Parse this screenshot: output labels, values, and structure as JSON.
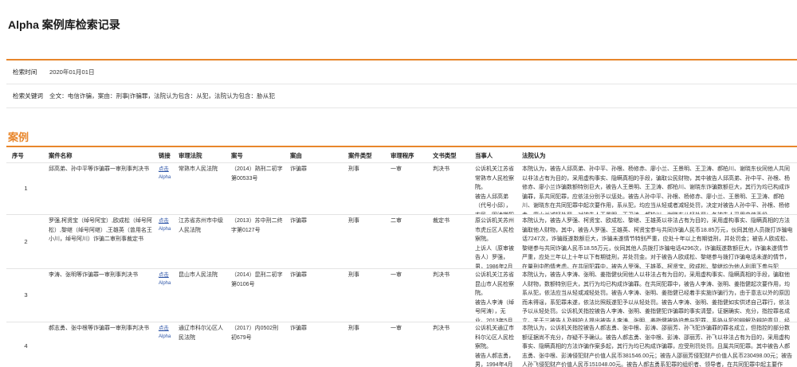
{
  "page": {
    "title": "Alpha 案例库检索记录"
  },
  "search": {
    "time_label": "检索时间",
    "time_value": "2020年01月01日",
    "keywords_label": "检索关键词",
    "keywords_value": "全文：电信诈骗，案由：刑事|诈骗罪，法院认为包含：从犯，法院认为包含：胁从犯"
  },
  "colors": {
    "accent": "#e8862b",
    "link": "#2f56a8"
  },
  "cases": {
    "section_title": "案例",
    "columns": [
      "序号",
      "案件名称",
      "链接",
      "审理法院",
      "案号",
      "案由",
      "案件类型",
      "审理程序",
      "文书类型",
      "当事人",
      "法院认为"
    ],
    "rows": [
      {
        "no": "1",
        "name": "邱高弟、孙中平等诈骗罪一审刑事判决书",
        "link_label": "点击",
        "link_brand": "Alpha",
        "court": "常熟市人民法院",
        "case_no": "（2014）熟刑二初字第00533号",
        "cause": "诈骗罪",
        "type": "刑事",
        "procedure": "一审",
        "doc_type": "判决书",
        "parties": "公诉机关江苏省常熟市人民检察院。\n被告人邱高弟（代号小邱），农民，因涉嫌犯",
        "opinion": "本院认为，被告人邱高弟、孙中平、孙根、杨修赤、廖小兰、王景明、王卫涛、郝柏川、谢晓东伙同他人共同以非法占有为目的，采用虚构事实、隐瞒真相的手段，骗取公民财物，其中被告人邱高弟、孙中平、孙根、杨修赤、廖小兰诈骗数额特别巨大，被告人王景明、王卫涛、郝柏川、谢晓东诈骗数额巨大，其行为均已构成诈骗罪，系共同犯罪，应依法分别予以惩处。被告人孙中平、孙根、杨修赤、廖小兰、王景明、王卫涛、郝柏川、谢晓东在共同犯罪中起次要作用，系从犯，均应当从轻或者减轻处罚，决定对被告人孙中平、孙根、杨修赤、廖小兰减轻处罚，对被告人王景明、王卫涛、郝柏川、谢晓东从轻处罚；各被告人采用电信手段"
      },
      {
        "no": "2",
        "name": "罗强,柯贤宝（绰号阿宝）,欧成松（绰号阿松）,黎继（绰号阿继）,王雄英（曾用名王小川，绰号阿川）诈骗二审刑事裁定书",
        "link_label": "点击",
        "link_brand": "Alpha",
        "court": "江苏省苏州市中级人民法院",
        "case_no": "（2013）苏中刑二终字第0127号",
        "cause": "诈骗罪",
        "type": "刑事",
        "procedure": "二审",
        "doc_type": "裁定书",
        "parties": "原公诉机关苏州市虎丘区人民检察院。\n上诉人（原审被告人）罗强，男，1986年2月",
        "opinion": "本院认为，被告人罗强、柯贤宝、欧成松、黎继、王雄英以非法占有为目的，采用虚构事实、隐瞒真相的方法骗取他人财物，其中，被告人罗强、王雄英、柯贤宝参与共同诈骗人民币18.85万元，伙同其他人员拨打诈骗电话7247次，诈骗既遂数额巨大，诈骗未遂情节特别严重，应处十年以上有期徒刑，并处罚金；被告人欧成松、黎继参与共同诈骗人民币18.55万元，伙同其他人员拨打诈骗电话4296次，诈骗既遂数额巨大，诈骗未遂情节严重，应处三年以上十年以下有期徒刑，并处罚金。对于被告人欧成松、黎继参与拨打诈骗电话未遂的情节，在量刑中酌情考虑。在共同犯罪中，被告人罗强、王雄英、柯贤宝、欧成松、黎继均为他人利用下参与犯"
      },
      {
        "no": "3",
        "name": "李涛、张明等诈骗罪一审刑事判决书",
        "link_label": "点击",
        "link_brand": "Alpha",
        "court": "昆山市人民法院",
        "case_no": "（2014）昆刑二初字第0106号",
        "cause": "诈骗罪",
        "type": "刑事",
        "procedure": "一审",
        "doc_type": "判决书",
        "parties": "公诉机关江苏省昆山市人民检察院。\n被告人李涛（绰号阿涛），无业。2013年5月",
        "opinion": "本院认为，被告人李涛、张明、姜指健伙同他人以非法占有为目的，采用虚构事实、隐瞒真相的手段，骗取他人财物，数额特别巨大，其行为均已构成诈骗罪。在共同犯罪中，被告人李涛、张明、姜指健起次要作用，均系从犯，依法应当从轻或减轻处罚。被告人李涛、张明、姜指健已经着手实施诈骗行为，由于意志以外的原因而未得逞，系犯罪未遂，依法比照既遂犯予以从轻处罚。被告人李涛、张明、姜指健如实供述自己罪行，依法予以从轻处罚。公诉机关指控被告人李涛、张明、姜指健犯诈骗罪的事实清楚，证据确实、充分，指控罪名成立。关于三被告人及辩护人提出被告人李涛、张明、姜指健被胁迫参与犯罪，系胁从犯的辩解及辩护意见，经查，被告人李涛供述"
      },
      {
        "no": "4",
        "name": "郝志勇、张中根等诈骗罪一审刑事判决书",
        "link_label": "点击",
        "link_brand": "Alpha",
        "court": "通辽市科尔沁区人民法院",
        "case_no": "（2017）内0502刑初679号",
        "cause": "诈骗罪",
        "type": "刑事",
        "procedure": "一审",
        "doc_type": "判决书",
        "parties": "公诉机关通辽市科尔沁区人民检察院。\n被告人郝志勇，男，1994年4月",
        "opinion": "本院认为，公诉机关指控被告人郝志勇、张中根、彭涛、邵丽芳、孙飞犯诈骗罪的罪名成立，但指控的部分数额证据尚不充分，存疑不予确认。被告人郝志勇、张中根、彭涛、邵丽芳、孙飞以非法占有为目的，采用虚构事实、隐瞒真相的方法诈骗作案多起，其行为均已构成诈骗罪，应受刑罚处罚。且属共同犯罪。其中被告人郝志勇、张中根、彭涛侵犯财产价值人民币381546.00元；被告人邵丽芳侵犯财产价值人民币230498.00元；被告人孙飞侵犯财产价值人民币151048.00元。被告人郝志勇系犯罪的组织者、领导者，在共同犯罪中起主要作用，系"
      }
    ]
  }
}
